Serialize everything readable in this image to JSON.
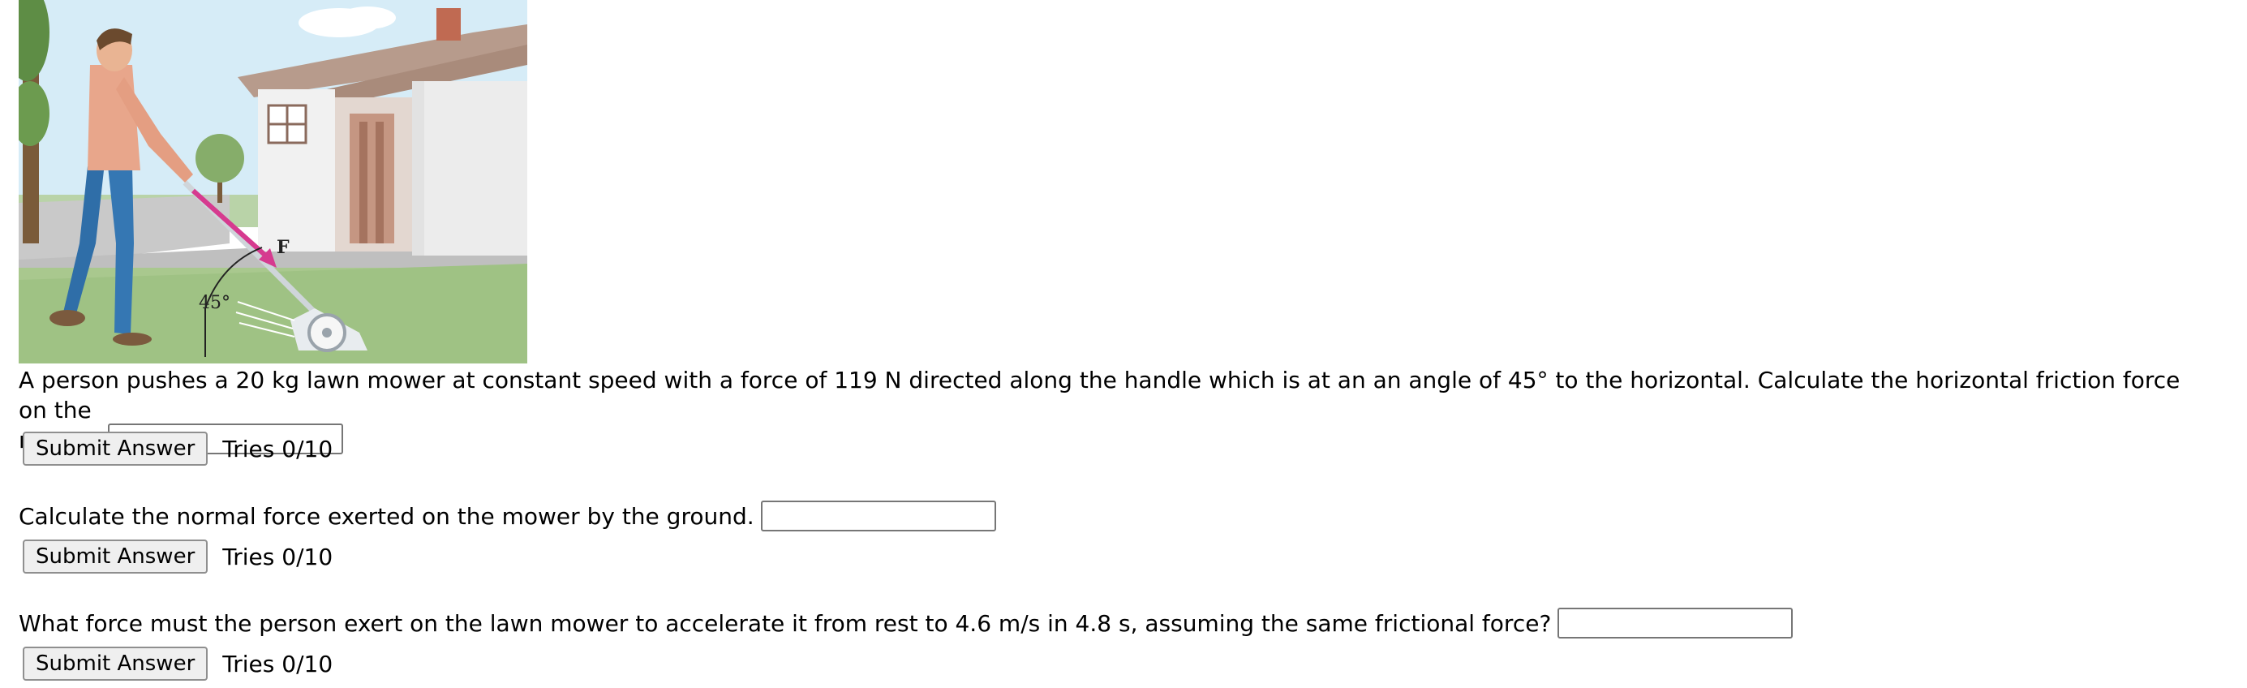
{
  "figure": {
    "force_label": "F",
    "angle_label": "45°"
  },
  "questions": [
    {
      "text_line1": "A person pushes a 20 kg lawn mower at constant speed with a force of 119 N directed along the handle which is at an an angle of 45° to the horizontal. Calculate the horizontal friction force on the",
      "text_line2": "mower.",
      "submit_label": "Submit Answer",
      "tries": "Tries 0/10"
    },
    {
      "text": "Calculate the normal force exerted on the mower by the ground.",
      "submit_label": "Submit Answer",
      "tries": "Tries 0/10"
    },
    {
      "text": "What force must the person exert on the lawn mower to accelerate it from rest to 4.6 m/s in 4.8 s, assuming the same frictional force?",
      "submit_label": "Submit Answer",
      "tries": "Tries 0/10"
    }
  ]
}
